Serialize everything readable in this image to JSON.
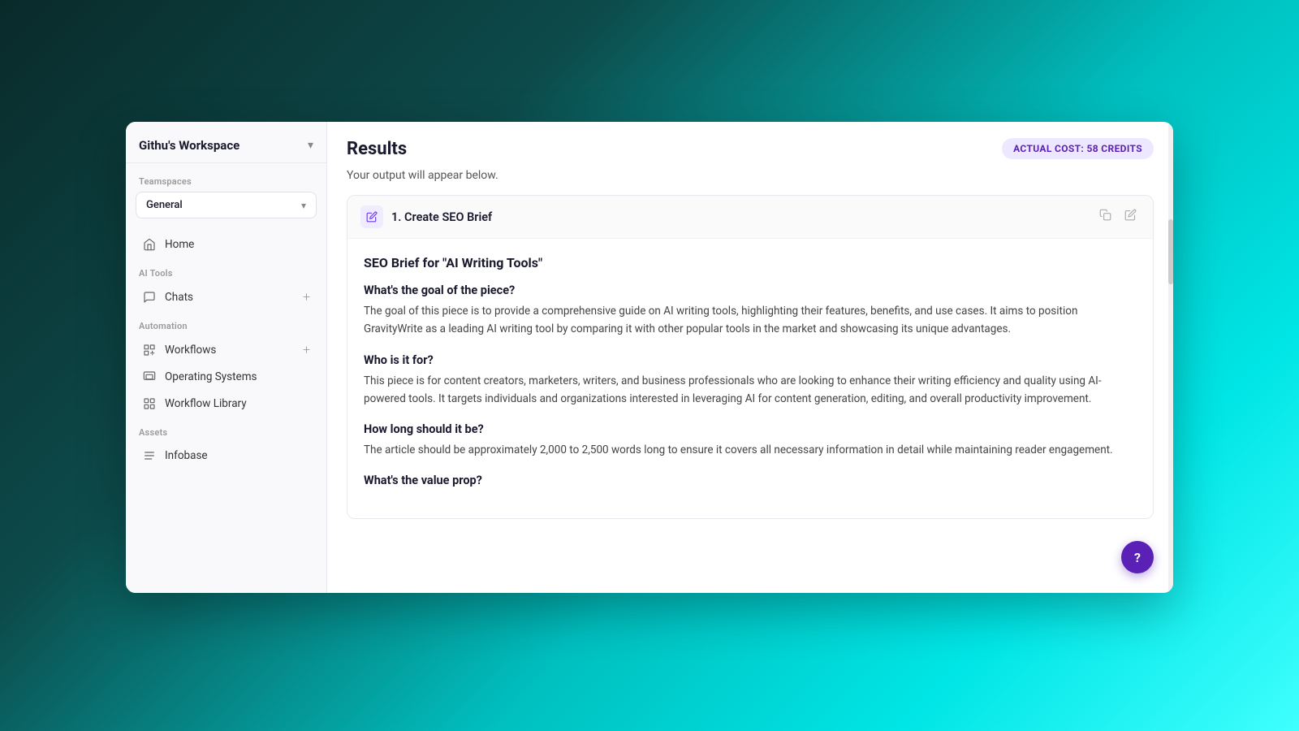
{
  "workspace": {
    "name": "Githu's Workspace",
    "chevron": "▾"
  },
  "sidebar": {
    "teamspaces_label": "Teamspaces",
    "teamspaces_selected": "General",
    "nav": {
      "home_label": "Home",
      "ai_tools_label": "AI Tools",
      "chats_label": "Chats",
      "automation_label": "Automation",
      "workflows_label": "Workflows",
      "operating_systems_label": "Operating Systems",
      "workflow_library_label": "Workflow Library",
      "assets_label": "Assets",
      "infobase_label": "Infobase"
    }
  },
  "results": {
    "title": "Results",
    "subtitle": "Your output will appear below.",
    "cost_badge": "ACTUAL COST:  58 CREDITS",
    "card": {
      "title": "1. Create SEO Brief",
      "seo_main_title": "SEO Brief for \"AI Writing Tools\"",
      "sections": [
        {
          "question": "What's the goal of the piece?",
          "answer": "The goal of this piece is to provide a comprehensive guide on AI writing tools, highlighting their features, benefits, and use cases. It aims to position GravityWrite as a leading AI writing tool by comparing it with other popular tools in the market and showcasing its unique advantages."
        },
        {
          "question": "Who is it for?",
          "answer": "This piece is for content creators, marketers, writers, and business professionals who are looking to enhance their writing efficiency and quality using AI-powered tools. It targets individuals and organizations interested in leveraging AI for content generation, editing, and overall productivity improvement."
        },
        {
          "question": "How long should it be?",
          "answer": "The article should be approximately 2,000 to 2,500 words long to ensure it covers all necessary information in detail while maintaining reader engagement."
        },
        {
          "question": "What's the value prop?",
          "answer": ""
        }
      ]
    }
  }
}
